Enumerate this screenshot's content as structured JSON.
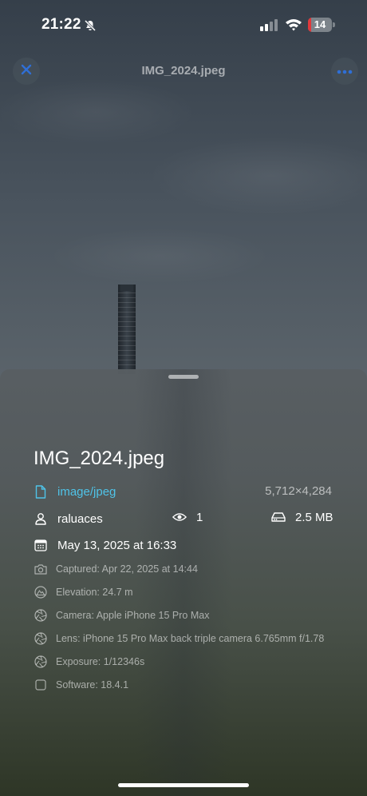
{
  "status": {
    "time": "21:22",
    "battery": "14",
    "battery_level": 0.14
  },
  "nav": {
    "title": "IMG_2024.jpeg",
    "back_icon": "close-icon",
    "more_icon": "ellipsis-icon"
  },
  "sheet": {
    "title": "IMG_2024.jpeg",
    "mime": "image/jpeg",
    "dimensions": "5,712×4,284",
    "owner": "raluaces",
    "views": "1",
    "size": "2.5 MB",
    "date": "May 13, 2025 at 16:33",
    "metadata": [
      {
        "icon": "camera-icon",
        "text": "Captured: Apr 22, 2025 at 14:44"
      },
      {
        "icon": "mountain-icon",
        "text": "Elevation: 24.7 m"
      },
      {
        "icon": "aperture-icon",
        "text": "Camera: Apple iPhone 15 Pro Max"
      },
      {
        "icon": "aperture-icon",
        "text": "Lens: iPhone 15 Pro Max back triple camera 6.765mm f/1.78"
      },
      {
        "icon": "aperture-icon",
        "text": "Exposure: 1/12346s"
      },
      {
        "icon": "square-icon",
        "text": "Software: 18.4.1"
      }
    ]
  },
  "colors": {
    "accent": "#4fc3e8",
    "battery_low": "#e0383b"
  }
}
